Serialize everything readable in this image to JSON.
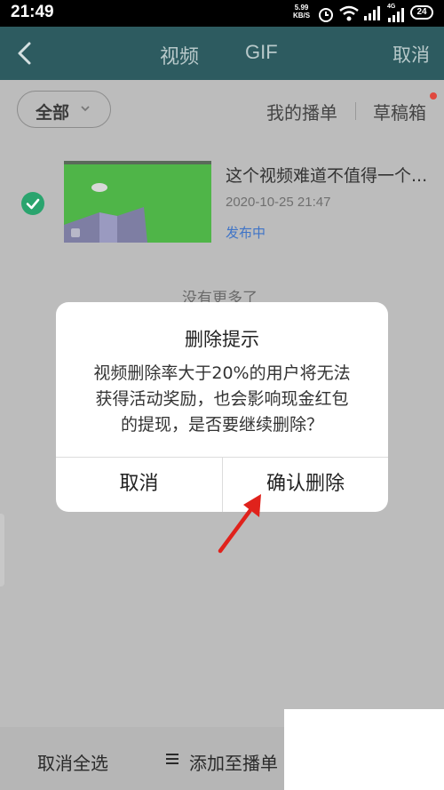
{
  "status_bar": {
    "time": "21:49",
    "speed_value": "5.99",
    "speed_unit": "KB/S",
    "network": "4G",
    "battery": "24"
  },
  "nav": {
    "tabs": [
      {
        "label": "视频"
      },
      {
        "label": "GIF"
      }
    ],
    "cancel_label": "取消"
  },
  "filter": {
    "selected": "全部",
    "my_playlist": "我的播单",
    "drafts": "草稿箱"
  },
  "video": {
    "title": "这个视频难道不值得一个...",
    "date": "2020-10-25 21:47",
    "status": "发布中"
  },
  "list_end": "没有更多了",
  "dialog": {
    "title": "删除提示",
    "message_lines": [
      "视频删除率大于20%的用户将无法",
      "获得活动奖励，也会影响现金红包",
      "的提现，是否要继续删除？"
    ],
    "cancel": "取消",
    "confirm": "确认删除"
  },
  "bottom_bar": {
    "deselect_all": "取消全选",
    "add_to_playlist": "添加至播单"
  },
  "colors": {
    "nav_bg": "#2d5b60",
    "check": "#2aa46e",
    "status_link": "#3f74c7",
    "badge": "#e0483e",
    "annotation_arrow": "#e0221c"
  }
}
